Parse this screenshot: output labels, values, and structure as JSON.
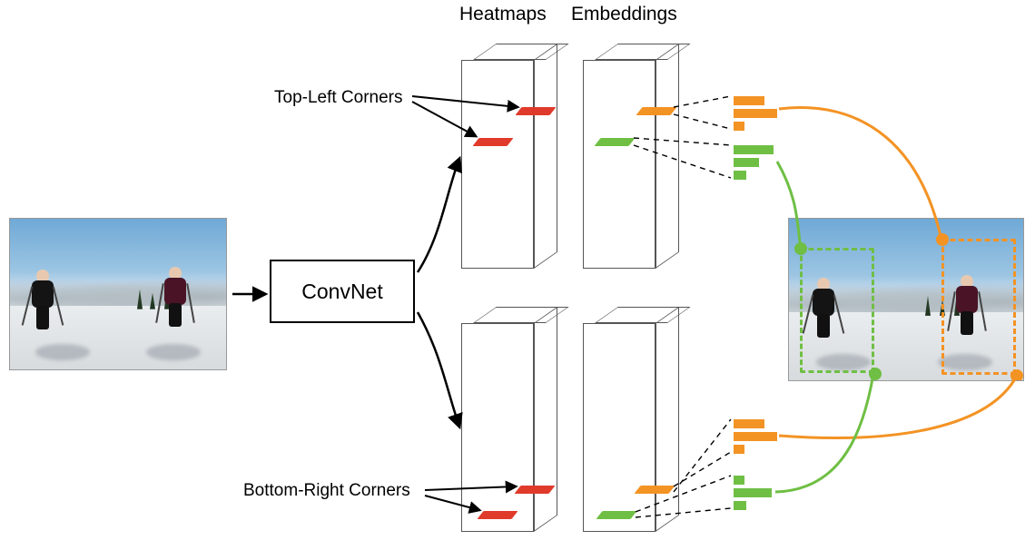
{
  "headers": {
    "heatmaps": "Heatmaps",
    "embeddings": "Embeddings"
  },
  "labels": {
    "top_left_corners": "Top-Left Corners",
    "bottom_right_corners": "Bottom-Right Corners",
    "convnet": "ConvNet"
  },
  "colors": {
    "heatmap_bar": "#E03A2B",
    "embed_orange": "#F39324",
    "embed_green": "#6FBF44",
    "bbox_orange": "#F39324",
    "bbox_green": "#6FBF44"
  },
  "scene": {
    "people": [
      "dark-jacket",
      "maroon-jacket"
    ]
  }
}
